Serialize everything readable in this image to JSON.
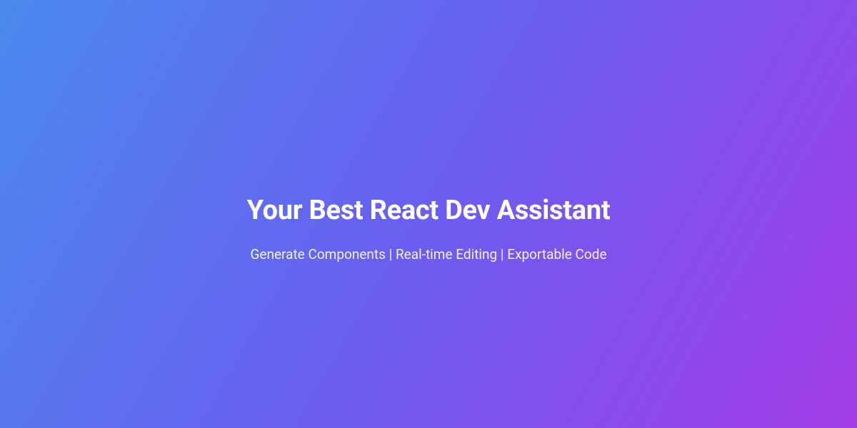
{
  "hero": {
    "headline": "Your Best React Dev Assistant",
    "subline": "Generate Components | Real-time Editing | Exportable Code"
  },
  "colors": {
    "gradient_start": "#4a8aee",
    "gradient_mid": "#6a5ef0",
    "gradient_end": "#a43de8",
    "text_primary": "#ffffff"
  }
}
